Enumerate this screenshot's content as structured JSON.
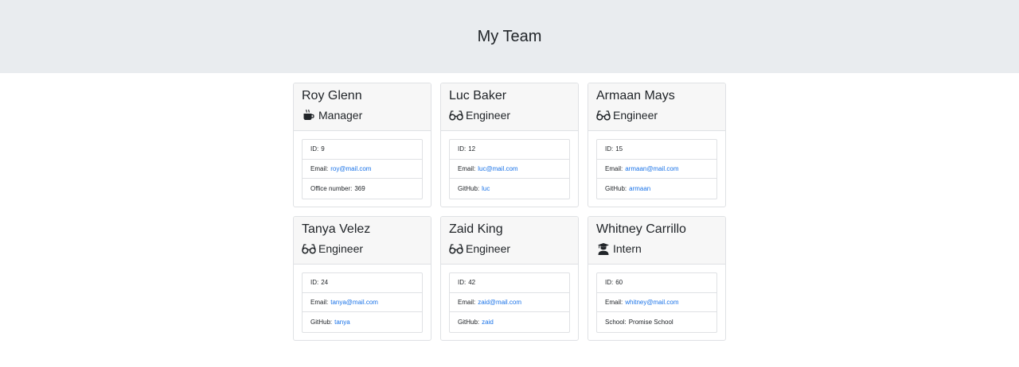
{
  "page": {
    "title": "My Team"
  },
  "colors": {
    "link": "#1a73e8",
    "header_bg": "#e9ecef",
    "card_header_bg": "#f7f7f7"
  },
  "members": [
    {
      "name": "Roy Glenn",
      "role": "Manager",
      "icon": "coffee-icon",
      "id_label": "ID:",
      "id": "9",
      "email_label": "Email:",
      "email": "roy@mail.com",
      "extra_label": "Office number:",
      "extra": "369",
      "extra_is_link": false
    },
    {
      "name": "Luc Baker",
      "role": "Engineer",
      "icon": "glasses-icon",
      "id_label": "ID:",
      "id": "12",
      "email_label": "Email:",
      "email": "luc@mail.com",
      "extra_label": "GitHub:",
      "extra": "luc",
      "extra_is_link": true
    },
    {
      "name": "Armaan Mays",
      "role": "Engineer",
      "icon": "glasses-icon",
      "id_label": "ID:",
      "id": "15",
      "email_label": "Email:",
      "email": "armaan@mail.com",
      "extra_label": "GitHub:",
      "extra": "armaan",
      "extra_is_link": true
    },
    {
      "name": "Tanya Velez",
      "role": "Engineer",
      "icon": "glasses-icon",
      "id_label": "ID:",
      "id": "24",
      "email_label": "Email:",
      "email": "tanya@mail.com",
      "extra_label": "GitHub:",
      "extra": "tanya",
      "extra_is_link": true
    },
    {
      "name": "Zaid King",
      "role": "Engineer",
      "icon": "glasses-icon",
      "id_label": "ID:",
      "id": "42",
      "email_label": "Email:",
      "email": "zaid@mail.com",
      "extra_label": "GitHub:",
      "extra": "zaid",
      "extra_is_link": true
    },
    {
      "name": "Whitney Carrillo",
      "role": "Intern",
      "icon": "graduate-icon",
      "id_label": "ID:",
      "id": "60",
      "email_label": "Email:",
      "email": "whitney@mail.com",
      "extra_label": "School:",
      "extra": "Promise School",
      "extra_is_link": false
    }
  ]
}
